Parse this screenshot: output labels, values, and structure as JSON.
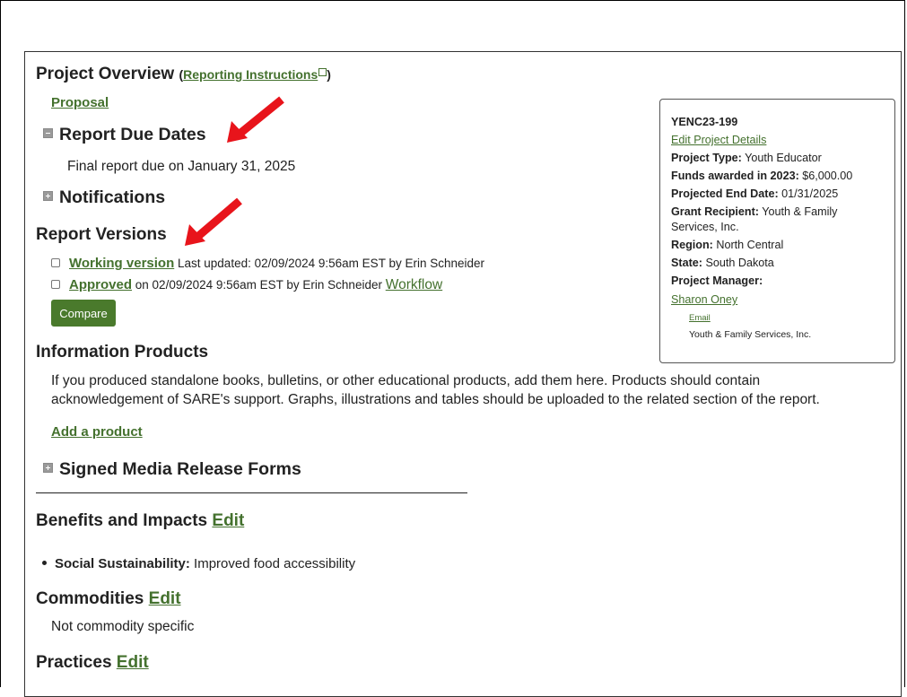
{
  "overview": {
    "title": "Project Overview",
    "paren_open": "(",
    "instructions_link": "Reporting Instructions",
    "paren_close": ")",
    "proposal_link": "Proposal"
  },
  "due_dates": {
    "heading": "Report Due Dates",
    "text": "Final report due on January 31, 2025"
  },
  "notifications": {
    "heading": "Notifications"
  },
  "report_versions": {
    "heading": "Report Versions",
    "working_link": "Working version",
    "working_meta": "Last updated: 02/09/2024 9:56am EST by Erin Schneider",
    "approved_link": "Approved",
    "approved_meta": "on 02/09/2024 9:56am EST by Erin Schneider",
    "workflow_link": "Workflow",
    "compare_label": "Compare"
  },
  "information_products": {
    "heading": "Information Products",
    "line1": "If you produced standalone books, bulletins, or other educational products, add them here. Products should contain",
    "line2": "acknowledgement of SARE's support. Graphs, illustrations and tables should be uploaded to the related section of the report.",
    "add_link": "Add a product"
  },
  "media_release": {
    "heading": "Signed Media Release Forms"
  },
  "benefits": {
    "heading": "Benefits and Impacts",
    "edit": "Edit",
    "item_label": "Social Sustainability:",
    "item_value": "Improved food accessibility"
  },
  "commodities": {
    "heading": "Commodities",
    "edit": "Edit",
    "text": "Not commodity specific"
  },
  "practices": {
    "heading": "Practices",
    "edit": "Edit"
  },
  "sidebar": {
    "project_id": "YENC23-199",
    "edit_details": "Edit Project Details",
    "project_type_label": "Project Type:",
    "project_type": "Youth Educator",
    "funds_label": "Funds awarded in 2023:",
    "funds": "$6,000.00",
    "end_date_label": "Projected End Date:",
    "end_date": "01/31/2025",
    "recipient_label": "Grant Recipient:",
    "recipient_line1": "Youth & Family",
    "recipient_line2": "Services, Inc.",
    "region_label": "Region:",
    "region": "North Central",
    "state_label": "State:",
    "state": "South Dakota",
    "manager_label": "Project Manager:",
    "manager_link": "Sharon Oney",
    "email_link": "Email",
    "organization": "Youth & Family Services, Inc."
  },
  "colors": {
    "link": "#44712e",
    "button": "#4a7a2c",
    "arrow": "#e8141b"
  }
}
